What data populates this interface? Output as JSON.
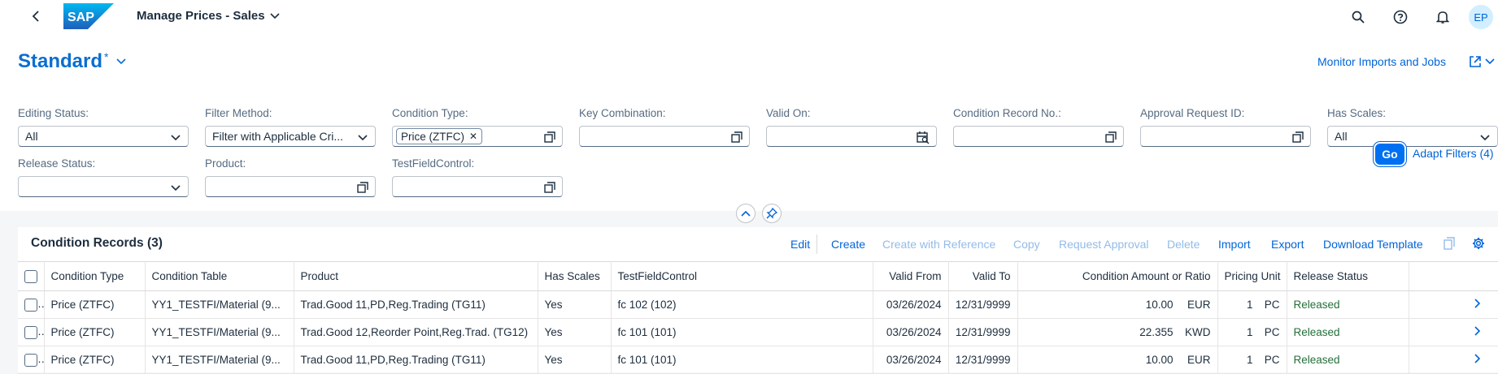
{
  "shell": {
    "logo_text": "SAP",
    "app_title": "Manage Prices - Sales",
    "avatar_initials": "EP"
  },
  "variant": {
    "name": "Standard",
    "modified_marker": "*"
  },
  "header_links": {
    "monitor": "Monitor Imports and Jobs"
  },
  "filters": [
    {
      "label": "Editing Status:",
      "value": "All",
      "kind": "select"
    },
    {
      "label": "Filter Method:",
      "value": "Filter with Applicable Cri...",
      "kind": "select"
    },
    {
      "label": "Condition Type:",
      "value": "",
      "token": "Price (ZTFC)",
      "kind": "valuehelp"
    },
    {
      "label": "Key Combination:",
      "value": "",
      "kind": "valuehelp"
    },
    {
      "label": "Valid On:",
      "value": "",
      "kind": "date"
    },
    {
      "label": "Condition Record No.:",
      "value": "",
      "kind": "valuehelp"
    },
    {
      "label": "Approval Request ID:",
      "value": "",
      "kind": "valuehelp"
    },
    {
      "label": "Has Scales:",
      "value": "All",
      "kind": "select"
    },
    {
      "label": "Release Status:",
      "value": "",
      "kind": "select"
    },
    {
      "label": "Product:",
      "value": "",
      "kind": "valuehelp"
    },
    {
      "label": "TestFieldControl:",
      "value": "",
      "kind": "valuehelp"
    }
  ],
  "filterbar": {
    "go": "Go",
    "adapt": "Adapt Filters (4)"
  },
  "table": {
    "title": "Condition Records (3)",
    "actions": {
      "edit": "Edit",
      "create": "Create",
      "create_ref": "Create with Reference",
      "copy": "Copy",
      "request_approval": "Request Approval",
      "delete": "Delete",
      "import": "Import",
      "export": "Export",
      "download_template": "Download Template"
    },
    "columns": [
      "Condition Type",
      "Condition Table",
      "Product",
      "Has Scales",
      "TestFieldControl",
      "Valid From",
      "Valid To",
      "Condition Amount or Ratio",
      "Pricing Unit",
      "Release Status"
    ],
    "rows": [
      {
        "cond_type": "Price (ZTFC)",
        "cond_table": "YY1_TESTFI/Material (9...",
        "product": "Trad.Good 11,PD,Reg.Trading (TG11)",
        "has_scales": "Yes",
        "tfc": "fc 102 (102)",
        "valid_from": "03/26/2024",
        "valid_to": "12/31/9999",
        "amount": "10.00",
        "currency": "EUR",
        "pricing_unit": "1",
        "uom": "PC",
        "release": "Released"
      },
      {
        "cond_type": "Price (ZTFC)",
        "cond_table": "YY1_TESTFI/Material (9...",
        "product": "Trad.Good 12,Reorder Point,Reg.Trad. (TG12)",
        "has_scales": "Yes",
        "tfc": "fc 101 (101)",
        "valid_from": "03/26/2024",
        "valid_to": "12/31/9999",
        "amount": "22.355",
        "currency": "KWD",
        "pricing_unit": "1",
        "uom": "PC",
        "release": "Released"
      },
      {
        "cond_type": "Price (ZTFC)",
        "cond_table": "YY1_TESTFI/Material (9...",
        "product": "Trad.Good 11,PD,Reg.Trading (TG11)",
        "has_scales": "Yes",
        "tfc": "fc 101 (101)",
        "valid_from": "03/26/2024",
        "valid_to": "12/31/9999",
        "amount": "10.00",
        "currency": "EUR",
        "pricing_unit": "1",
        "uom": "PC",
        "release": "Released"
      }
    ]
  },
  "colors": {
    "brand": "#0a6ed1",
    "link": "#0064d9",
    "positive": "#256f3a",
    "background": "#f5f6f7"
  }
}
